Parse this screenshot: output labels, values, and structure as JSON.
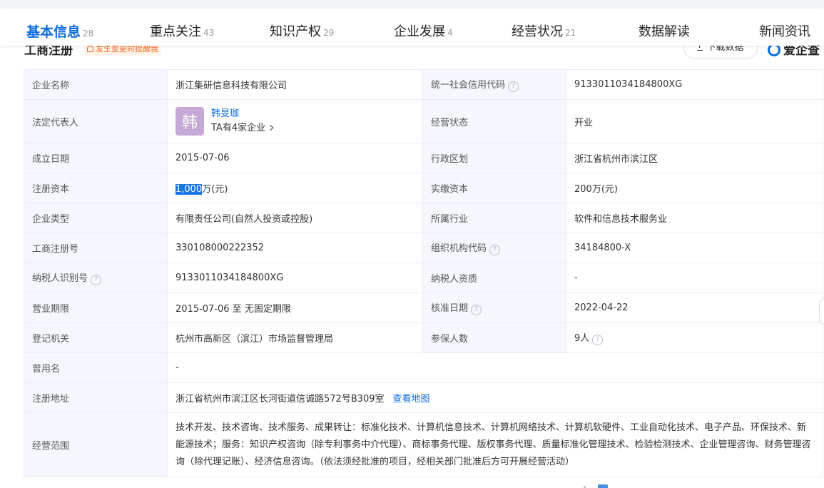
{
  "tabs": [
    {
      "label": "基本信息",
      "count": "28"
    },
    {
      "label": "重点关注",
      "count": "43"
    },
    {
      "label": "知识产权",
      "count": "29"
    },
    {
      "label": "企业发展",
      "count": "4"
    },
    {
      "label": "经营状况",
      "count": "21"
    },
    {
      "label": "数据解读",
      "count": ""
    },
    {
      "label": "新闻资讯",
      "count": ""
    }
  ],
  "section": {
    "title": "工商注册",
    "remind_label": "发生变更时提醒我",
    "download_label": "下载数据",
    "brand_label": "爱企查"
  },
  "info": {
    "company_name": {
      "label": "企业名称",
      "value": "浙江集研信息科技有限公司"
    },
    "credit_code": {
      "label": "统一社会信用代码",
      "value": "913301103418480 0XG"
    },
    "legal_rep": {
      "label": "法定代表人",
      "avatar_char": "韩",
      "name": "韩旻珈",
      "sub": "TA有4家企业"
    },
    "status": {
      "label": "经营状态",
      "value": "开业"
    },
    "found_date": {
      "label": "成立日期",
      "value": "2015-07-06"
    },
    "region": {
      "label": "行政区划",
      "value": "浙江省杭州市滨江区"
    },
    "reg_capital": {
      "label": "注册资本",
      "value_selected": "1,000",
      "value_rest": "万(元)"
    },
    "paid_capital": {
      "label": "实缴资本",
      "value": "200万(元)"
    },
    "company_type": {
      "label": "企业类型",
      "value": "有限责任公司(自然人投资或控股)"
    },
    "industry": {
      "label": "所属行业",
      "value": "软件和信息技术服务业"
    },
    "reg_no": {
      "label": "工商注册号",
      "value": "330108000222352"
    },
    "org_code": {
      "label": "组织机构代码",
      "value": "34184800-X"
    },
    "taxpayer_id": {
      "label": "纳税人识别号",
      "value": "913301103418480 0XG"
    },
    "taxpayer_qual": {
      "label": "纳税人资质",
      "value": "-"
    },
    "biz_term": {
      "label": "营业期限",
      "value": "2015-07-06 至 无固定期限"
    },
    "approve_date": {
      "label": "核准日期",
      "value": "2022-04-22"
    },
    "reg_authority": {
      "label": "登记机关",
      "value": "杭州市高新区（滨江）市场监督管理局"
    },
    "insured": {
      "label": "参保人数",
      "value": "9人"
    },
    "former_name": {
      "label": "曾用名",
      "value": "-"
    },
    "reg_address": {
      "label": "注册地址",
      "value": "浙江省杭州市滨江区长河街道信诚路572号B309室",
      "map_link": "查看地图"
    },
    "scope": {
      "label": "经营范围",
      "value": "技术开发、技术咨询、技术服务、成果转让：标准化技术、计算机信息技术、计算机网络技术、计算机软硬件、工业自动化技术、电子产品、环保技术、新能源技术；服务：知识产权咨询（除专利事务中介代理）、商标事务代理、版权事务代理、质量标准化管理技术、检验检测技术、企业管理咨询、财务管理咨询（除代理记账）、经济信息咨询。（依法须经批准的项目，经相关部门批准后方可开展经营活动）"
    }
  }
}
